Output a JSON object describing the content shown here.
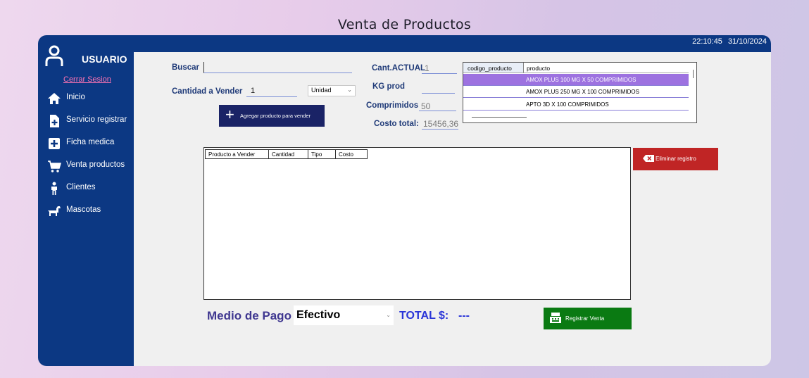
{
  "page": {
    "title": "Venta de Productos"
  },
  "topbar": {
    "time": "22:10:45",
    "date": "31/10/2024"
  },
  "sidebar": {
    "user_label": "USUARIO",
    "logout_label": "Cerrar Sesion",
    "items": [
      {
        "label": "Inicio",
        "icon": "home-icon"
      },
      {
        "label": "Servicio registrar",
        "icon": "file-add-icon"
      },
      {
        "label": "Ficha medica",
        "icon": "medical-record-icon"
      },
      {
        "label": "Venta productos",
        "icon": "cart-icon"
      },
      {
        "label": "Clientes",
        "icon": "person-icon"
      },
      {
        "label": "Mascotas",
        "icon": "dog-icon"
      }
    ]
  },
  "form": {
    "search_label": "Buscar",
    "search_value": "",
    "qty_label": "Cantidad a Vender",
    "qty_value": "1",
    "unit_select": "Unidad",
    "add_button": "Agregar producto para vender",
    "cant_actual_label": "Cant.ACTUAL",
    "cant_actual_value": "1",
    "kg_label": "KG prod",
    "kg_value": "",
    "comprimidos_label": "Comprimidos",
    "comprimidos_value": "50",
    "costo_label": "Costo total:",
    "costo_value": "15456,36"
  },
  "product_grid": {
    "columns": [
      "codigo_producto",
      "producto"
    ],
    "rows": [
      {
        "codigo": "",
        "producto": "AMOX PLUS 100 MG X 50 COMPRIMIDOS",
        "selected": true
      },
      {
        "codigo": "",
        "producto": "AMOX PLUS 250 MG X 100 COMPRIMIDOS",
        "selected": false
      },
      {
        "codigo": "",
        "producto": "APTO 3D X 100 COMPRIMIDOS",
        "selected": false
      }
    ]
  },
  "cart": {
    "columns": [
      "Producto a Vender",
      "Cantidad",
      "Tipo",
      "Costo"
    ]
  },
  "actions": {
    "delete_button": "Eliminar registro",
    "register_button": "Registrar Venta"
  },
  "payment": {
    "label": "Medio de Pago",
    "selected": "Efectivo",
    "total_label": "TOTAL $:",
    "total_value": "---"
  },
  "colors": {
    "sidebar": "#0c3883",
    "selected_row": "#9d72e0",
    "delete": "#c02525",
    "register": "#0a7a12",
    "add_button": "#1a2366"
  }
}
